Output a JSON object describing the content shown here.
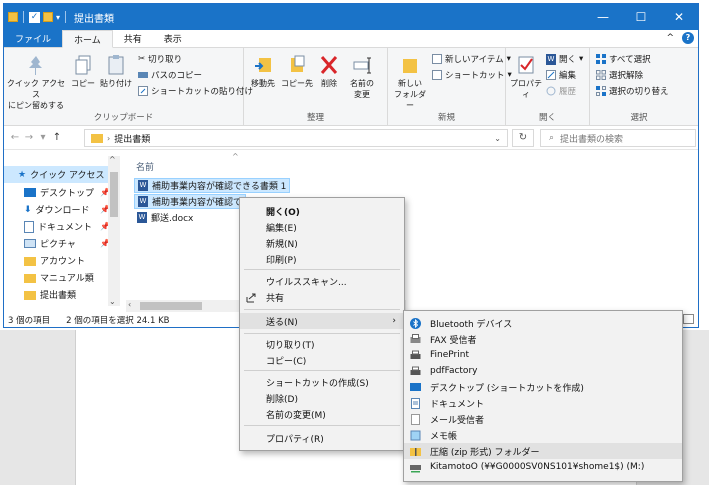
{
  "window": {
    "title": "提出書類",
    "controls": {
      "minimize": "—",
      "maximize": "☐",
      "close": "✕"
    }
  },
  "tabs": [
    {
      "label": "ファイル"
    },
    {
      "label": "ホーム"
    },
    {
      "label": "共有"
    },
    {
      "label": "表示"
    }
  ],
  "tabs_right": {
    "collapse": "^",
    "help": "?"
  },
  "ribbon": {
    "clipboard": {
      "label": "クリップボード",
      "pin": "クイック アクセス\nにピン留めする",
      "copy": "コピー",
      "paste": "貼り付け",
      "cut": "切り取り",
      "copy_path": "パスのコピー",
      "paste_shortcut": "ショートカットの貼り付け"
    },
    "organize": {
      "label": "整理",
      "move_to": "移動先",
      "copy_to": "コピー先",
      "delete": "削除",
      "rename": "名前の\n変更"
    },
    "new": {
      "label": "新規",
      "new_folder": "新しい\nフォルダー",
      "new_item": "新しいアイテム",
      "shortcut": "ショートカット"
    },
    "open": {
      "label": "開く",
      "properties": "プロパティ",
      "open": "開く",
      "edit": "編集",
      "history": "履歴"
    },
    "select": {
      "label": "選択",
      "select_all": "すべて選択",
      "select_none": "選択解除",
      "invert": "選択の切り替え"
    }
  },
  "address": {
    "path": "提出書類",
    "search_placeholder": "提出書類の検索"
  },
  "nav": [
    {
      "label": "クイック アクセス",
      "selected": true
    },
    {
      "label": "デスクトップ",
      "pinned": "📌"
    },
    {
      "label": "ダウンロード",
      "pinned": "📌"
    },
    {
      "label": "ドキュメント",
      "pinned": "📌"
    },
    {
      "label": "ピクチャ",
      "pinned": "📌"
    },
    {
      "label": "アカウント"
    },
    {
      "label": "マニュアル類"
    },
    {
      "label": "提出書類"
    }
  ],
  "files": {
    "column_name": "名前",
    "rows": [
      {
        "name": "補助事業内容が確認できる書類 1",
        "selected": true
      },
      {
        "name": "補助事業内容が確認で",
        "selected": true
      },
      {
        "name": "郵送.docx",
        "selected": false
      }
    ]
  },
  "status": {
    "count": "3 個の項目",
    "selection": "2 個の項目を選択  24.1 KB"
  },
  "context_menu": [
    "開く(O)",
    "編集(E)",
    "新規(N)",
    "印刷(P)",
    "ウイルススキャン...",
    "共有",
    "送る(N)",
    "切り取り(T)",
    "コピー(C)",
    "ショートカットの作成(S)",
    "削除(D)",
    "名前の変更(M)",
    "プロパティ(R)"
  ],
  "send_to_menu": [
    "Bluetooth デバイス",
    "FAX 受信者",
    "FinePrint",
    "pdfFactory",
    "デスクトップ (ショートカットを作成)",
    "ドキュメント",
    "メール受信者",
    "メモ帳",
    "圧縮 (zip 形式) フォルダー",
    "KitamotoO (¥¥G0000SV0NS101¥shome1$) (M:)"
  ],
  "colors": {
    "accent": "#1a73c8",
    "selection": "#cce8ff",
    "folder": "#f3c244"
  }
}
